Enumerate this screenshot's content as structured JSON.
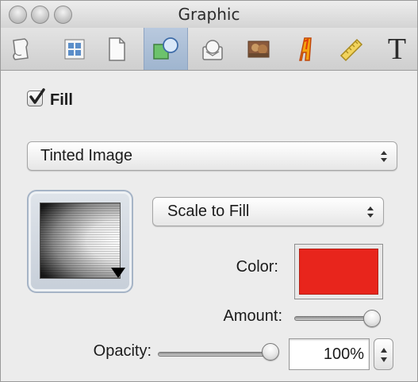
{
  "window": {
    "title": "Graphic"
  },
  "toolbar": {
    "tabs": [
      {
        "name": "document-tab",
        "icon": "document-icon"
      },
      {
        "name": "layout-tab",
        "icon": "grid-icon"
      },
      {
        "name": "page-tab",
        "icon": "page-icon"
      },
      {
        "name": "graphic-tab",
        "icon": "shapes-icon",
        "active": true
      },
      {
        "name": "text-wrap-tab",
        "icon": "text-box-icon"
      },
      {
        "name": "media-tab",
        "icon": "image-icon"
      },
      {
        "name": "style-tab",
        "icon": "stylized-a-icon"
      },
      {
        "name": "metrics-tab",
        "icon": "ruler-icon"
      },
      {
        "name": "text-tab",
        "icon": "text-icon",
        "glyph": "T"
      }
    ]
  },
  "fill": {
    "checkbox_checked": true,
    "label": "Fill",
    "type": "Tinted Image",
    "scale": "Scale to Fill",
    "color_label": "Color:",
    "color": "#e8251c",
    "amount_label": "Amount:",
    "amount": 1.0
  },
  "opacity": {
    "label": "Opacity:",
    "value": "100%",
    "fraction": 1.0
  }
}
